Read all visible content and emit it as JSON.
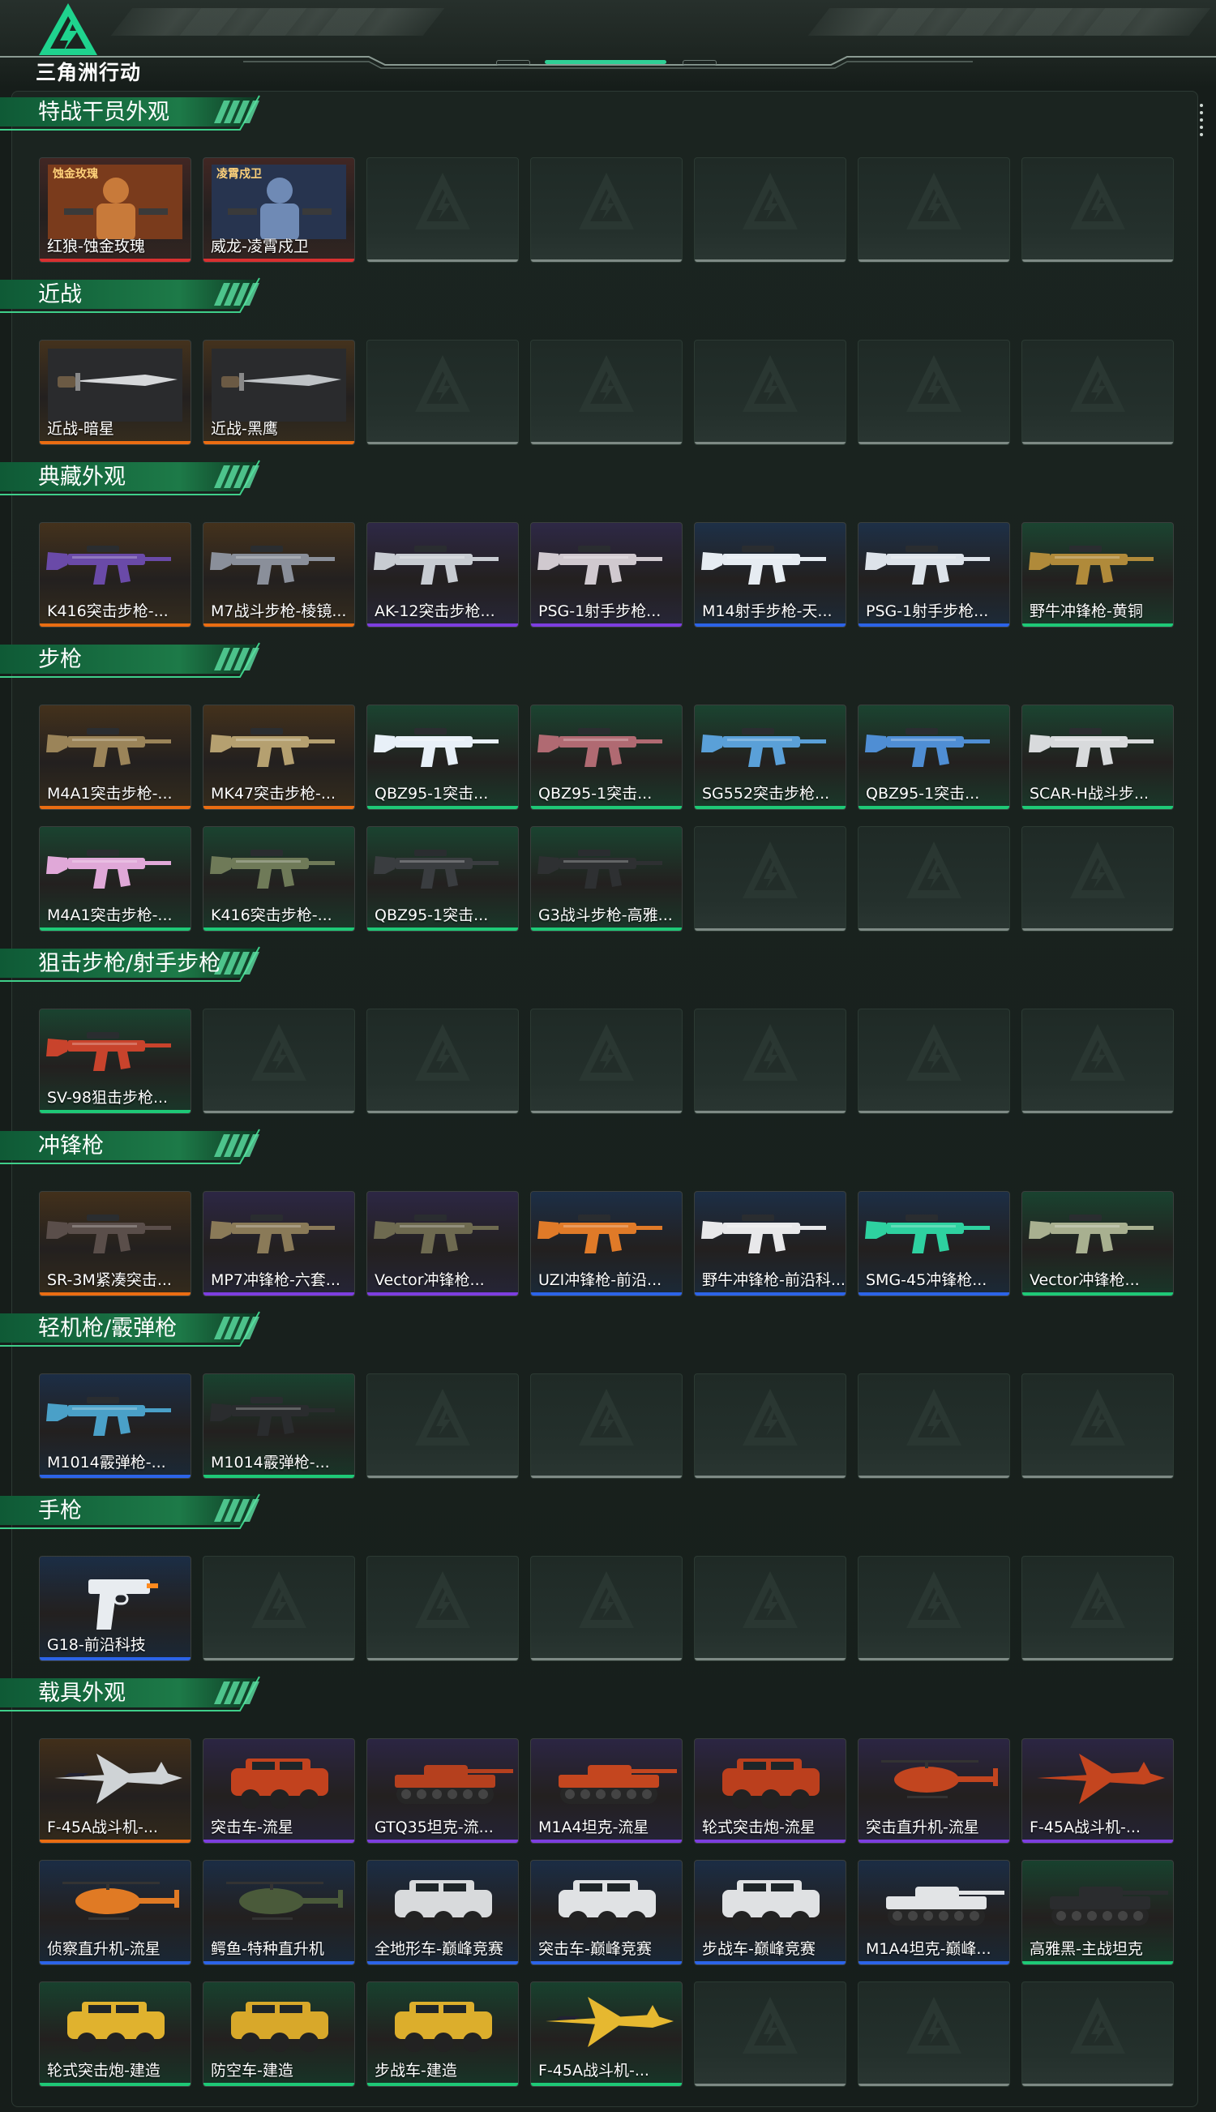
{
  "app": {
    "logo_text": "三角洲行动"
  },
  "rarity_colors": {
    "orange": "#ea6d12",
    "red": "#d93030",
    "purple": "#7d3ee0",
    "blue": "#2c64e8",
    "green": "#1ec977"
  },
  "sections": [
    {
      "title": "特战干员外观",
      "cards": [
        {
          "label": "红狼-蚀金玫瑰",
          "rarity": "red",
          "art": "operator",
          "photo_text": "蚀金玫瑰"
        },
        {
          "label": "威龙-凌霄戍卫",
          "rarity": "red",
          "art": "operator2",
          "photo_text": "凌霄戍卫"
        },
        null,
        null,
        null,
        null,
        null
      ]
    },
    {
      "title": "近战",
      "cards": [
        {
          "label": "近战-暗星",
          "rarity": "orange",
          "art": "knife"
        },
        {
          "label": "近战-黑鹰",
          "rarity": "orange",
          "art": "knife2"
        },
        null,
        null,
        null,
        null,
        null
      ]
    },
    {
      "title": "典藏外观",
      "cards": [
        {
          "label": "K416突击步枪-...",
          "rarity": "orange",
          "art": "gun",
          "color": "#6a4aa8"
        },
        {
          "label": "M7战斗步枪-棱镜...",
          "rarity": "orange",
          "art": "gun",
          "color": "#8a8f9a"
        },
        {
          "label": "AK-12突击步枪...",
          "rarity": "purple",
          "art": "gun",
          "color": "#c8ccd2"
        },
        {
          "label": "PSG-1射手步枪...",
          "rarity": "purple",
          "art": "gun",
          "color": "#d0c9cf"
        },
        {
          "label": "M14射手步枪-天...",
          "rarity": "blue",
          "art": "gun",
          "color": "#e6ecf2"
        },
        {
          "label": "PSG-1射手步枪...",
          "rarity": "blue",
          "art": "gun",
          "color": "#dde3ea"
        },
        {
          "label": "野牛冲锋枪-黄铜",
          "rarity": "green",
          "art": "gun",
          "color": "#b08a3a"
        }
      ]
    },
    {
      "title": "步枪",
      "cards": [
        {
          "label": "M4A1突击步枪-...",
          "rarity": "orange",
          "art": "gun",
          "color": "#9b8459"
        },
        {
          "label": "MK47突击步枪-...",
          "rarity": "orange",
          "art": "gun",
          "color": "#b5a070"
        },
        {
          "label": "QBZ95-1突击...",
          "rarity": "green",
          "art": "gun",
          "color": "#e8f0f8"
        },
        {
          "label": "QBZ95-1突击...",
          "rarity": "green",
          "art": "gun",
          "color": "#b06a72"
        },
        {
          "label": "SG552突击步枪...",
          "rarity": "green",
          "art": "gun",
          "color": "#5aa0d8"
        },
        {
          "label": "QBZ95-1突击...",
          "rarity": "green",
          "art": "gun",
          "color": "#4f8ed4"
        },
        {
          "label": "SCAR-H战斗步...",
          "rarity": "green",
          "art": "gun",
          "color": "#d8dadc"
        },
        {
          "label": "M4A1突击步枪-...",
          "rarity": "green",
          "art": "gun",
          "color": "#e0a8d8"
        },
        {
          "label": "K416突击步枪-...",
          "rarity": "green",
          "art": "gun",
          "color": "#6f7a58"
        },
        {
          "label": "QBZ95-1突击...",
          "rarity": "green",
          "art": "gun",
          "color": "#3a3d40"
        },
        {
          "label": "G3战斗步枪-高雅...",
          "rarity": "green",
          "art": "gun",
          "color": "#2e3032"
        },
        null,
        null,
        null
      ]
    },
    {
      "title": "狙击步枪/射手步枪",
      "cards": [
        {
          "label": "SV-98狙击步枪...",
          "rarity": "green",
          "art": "gun",
          "color": "#c8432c"
        },
        null,
        null,
        null,
        null,
        null,
        null
      ]
    },
    {
      "title": "冲锋枪",
      "cards": [
        {
          "label": "SR-3M紧凑突击...",
          "rarity": "orange",
          "art": "gun",
          "color": "#5a4e4a"
        },
        {
          "label": "MP7冲锋枪-六套...",
          "rarity": "purple",
          "art": "gun",
          "color": "#8a7a58"
        },
        {
          "label": "Vector冲锋枪...",
          "rarity": "purple",
          "art": "gun",
          "color": "#6e6a50"
        },
        {
          "label": "UZI冲锋枪-前沿...",
          "rarity": "blue",
          "art": "gun",
          "color": "#e07a28"
        },
        {
          "label": "野牛冲锋枪-前沿科...",
          "rarity": "blue",
          "art": "gun",
          "color": "#e8e8ea"
        },
        {
          "label": "SMG-45冲锋枪...",
          "rarity": "blue",
          "art": "gun",
          "color": "#2ed1a0"
        },
        {
          "label": "Vector冲锋枪...",
          "rarity": "green",
          "art": "gun",
          "color": "#a8b090"
        }
      ]
    },
    {
      "title": "轻机枪/霰弹枪",
      "cards": [
        {
          "label": "M1014霰弹枪-...",
          "rarity": "blue",
          "art": "gun",
          "color": "#4aa0c8"
        },
        {
          "label": "M1014霰弹枪-...",
          "rarity": "green",
          "art": "gun",
          "color": "#2a2c2e"
        },
        null,
        null,
        null,
        null,
        null
      ]
    },
    {
      "title": "手枪",
      "cards": [
        {
          "label": "G18-前沿科技",
          "rarity": "blue",
          "art": "pistol",
          "color": "#e8ecf0"
        },
        null,
        null,
        null,
        null,
        null,
        null
      ]
    },
    {
      "title": "载具外观",
      "cards": [
        {
          "label": "F-45A战斗机-...",
          "rarity": "orange",
          "art": "jet",
          "color": "#cfd3d6"
        },
        {
          "label": "突击车-流星",
          "rarity": "purple",
          "art": "car",
          "color": "#c2421e"
        },
        {
          "label": "GTQ35坦克-流...",
          "rarity": "purple",
          "art": "tank",
          "color": "#b5401e"
        },
        {
          "label": "M1A4坦克-流星",
          "rarity": "purple",
          "art": "tank",
          "color": "#c4461f"
        },
        {
          "label": "轮式突击炮-流星",
          "rarity": "purple",
          "art": "car",
          "color": "#bb3f1d"
        },
        {
          "label": "突击直升机-流星",
          "rarity": "purple",
          "art": "heli",
          "color": "#c2451f"
        },
        {
          "label": "F-45A战斗机-...",
          "rarity": "purple",
          "art": "jet",
          "color": "#c4451f"
        },
        {
          "label": "侦察直升机-流星",
          "rarity": "blue",
          "art": "heli",
          "color": "#e07a24"
        },
        {
          "label": "鳄鱼-特种直升机",
          "rarity": "blue",
          "art": "heli",
          "color": "#4a5a3a"
        },
        {
          "label": "全地形车-巅峰竞赛",
          "rarity": "blue",
          "art": "car",
          "color": "#d8dadc"
        },
        {
          "label": "突击车-巅峰竞赛",
          "rarity": "blue",
          "art": "car",
          "color": "#e0e2e4"
        },
        {
          "label": "步战车-巅峰竞赛",
          "rarity": "blue",
          "art": "car",
          "color": "#dfe1e3"
        },
        {
          "label": "M1A4坦克-巅峰...",
          "rarity": "blue",
          "art": "tank",
          "color": "#e2e4e6"
        },
        {
          "label": "高雅黑-主战坦克",
          "rarity": "green",
          "art": "tank",
          "color": "#2a2c2e"
        },
        {
          "label": "轮式突击炮-建造",
          "rarity": "green",
          "art": "car",
          "color": "#e0b22e"
        },
        {
          "label": "防空车-建造",
          "rarity": "green",
          "art": "car",
          "color": "#d8a82a"
        },
        {
          "label": "步战车-建造",
          "rarity": "green",
          "art": "car",
          "color": "#dcae2c"
        },
        {
          "label": "F-45A战斗机-...",
          "rarity": "green",
          "art": "jet",
          "color": "#e6b830"
        },
        null,
        null,
        null
      ]
    }
  ]
}
